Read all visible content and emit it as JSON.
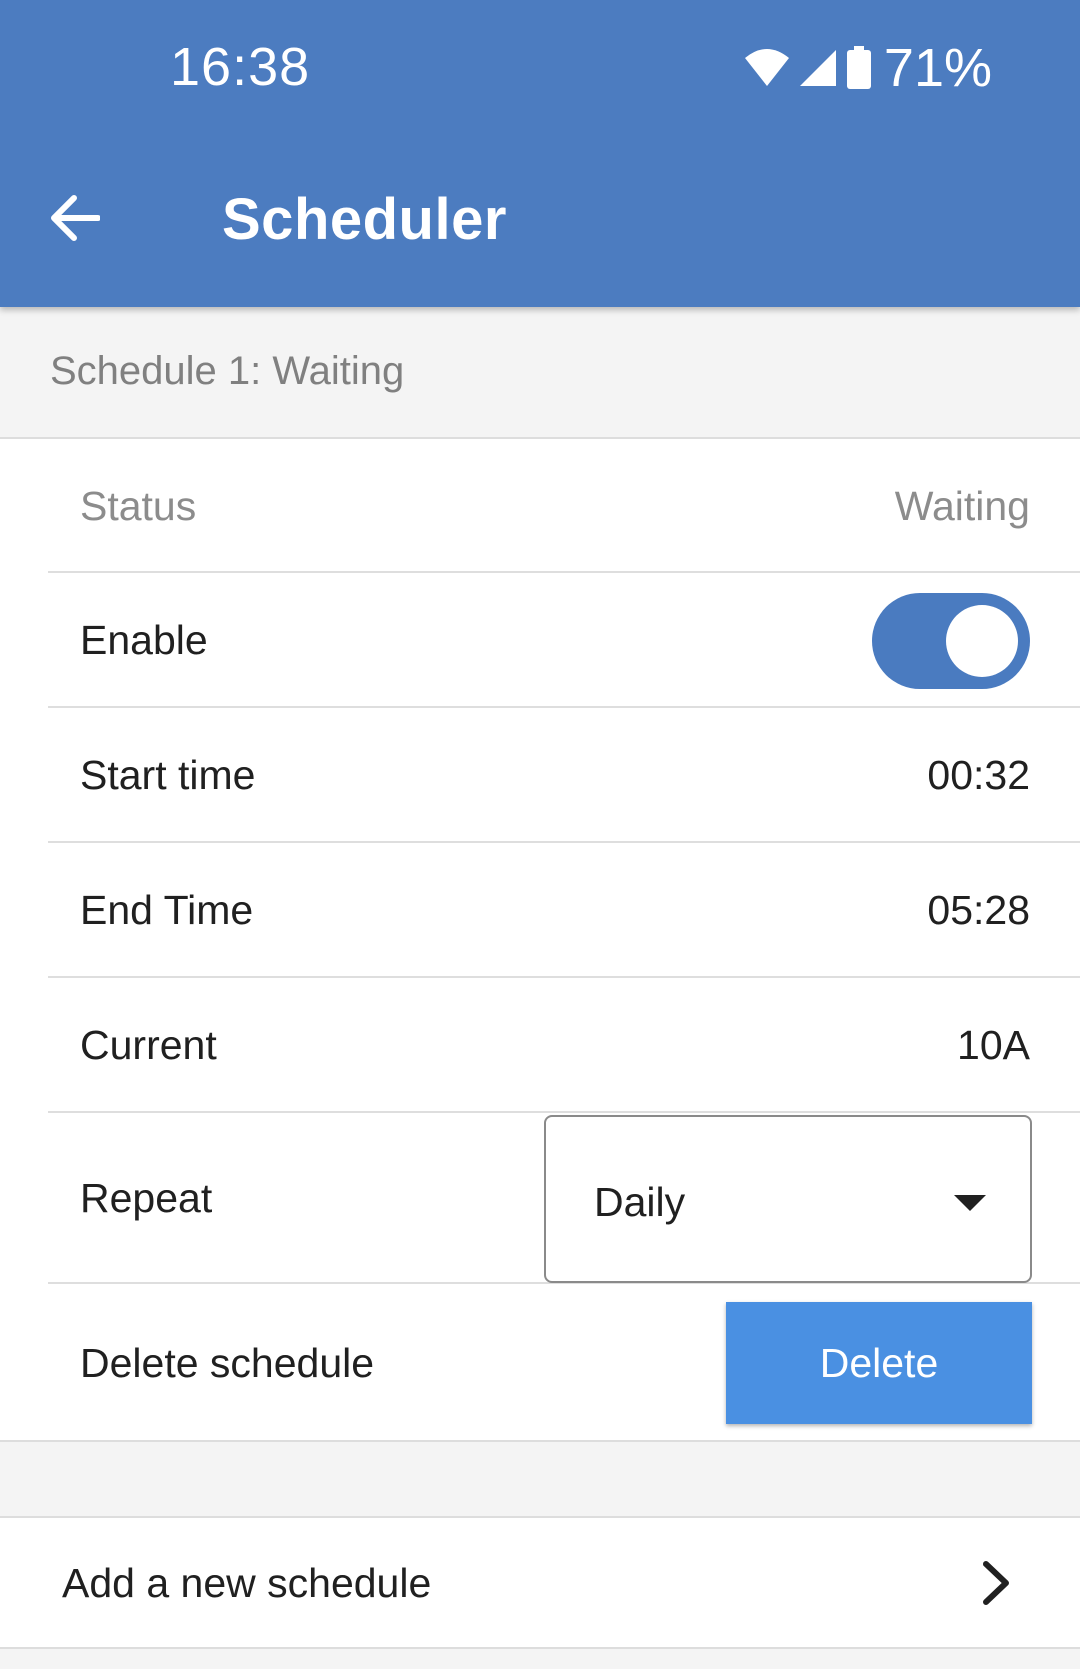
{
  "status_bar": {
    "time": "16:38",
    "battery": "71%",
    "icons": [
      "wifi-icon",
      "cell-signal-icon",
      "battery-icon"
    ]
  },
  "app_bar": {
    "title": "Scheduler",
    "back_icon": "arrow-left-icon"
  },
  "schedule": {
    "header": "Schedule 1: Waiting",
    "status_label": "Status",
    "status_value": "Waiting",
    "enable_label": "Enable",
    "enable_on": true,
    "start_label": "Start time",
    "start_value": "00:32",
    "end_label": "End Time",
    "end_value": "05:28",
    "current_label": "Current",
    "current_value": "10A",
    "repeat_label": "Repeat",
    "repeat_value": "Daily",
    "delete_label": "Delete schedule",
    "delete_button": "Delete"
  },
  "add_schedule": {
    "label": "Add a new schedule",
    "icon": "chevron-right-icon"
  },
  "colors": {
    "primary": "#4c7cc0",
    "button": "#4a90e2",
    "background": "#f4f4f4"
  }
}
